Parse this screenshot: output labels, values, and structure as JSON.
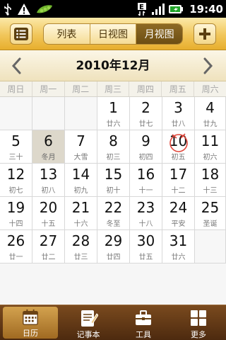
{
  "status_bar": {
    "time": "19:40",
    "left_icons": [
      "usb-icon",
      "warning-icon",
      "peapod-icon"
    ],
    "right_icons": [
      "e-network-icon",
      "signal-icon",
      "battery-icon"
    ]
  },
  "toolbar": {
    "menu_icon": "list-menu-icon",
    "add_icon": "plus-icon",
    "segments": [
      {
        "label": "列表",
        "active": false
      },
      {
        "label": "日视图",
        "active": false
      },
      {
        "label": "月视图",
        "active": true
      }
    ]
  },
  "month_header": {
    "title": "2010年12月",
    "prev_icon": "chevron-left-icon",
    "next_icon": "chevron-right-icon"
  },
  "weekdays": [
    "周日",
    "周一",
    "周二",
    "周三",
    "周四",
    "周五",
    "周六"
  ],
  "calendar": {
    "selected_day": "6",
    "today_marked": "10",
    "weeks": [
      [
        {
          "day": "",
          "lunar": ""
        },
        {
          "day": "",
          "lunar": ""
        },
        {
          "day": "",
          "lunar": ""
        },
        {
          "day": "1",
          "lunar": "廿六"
        },
        {
          "day": "2",
          "lunar": "廿七"
        },
        {
          "day": "3",
          "lunar": "廿八"
        },
        {
          "day": "4",
          "lunar": "廿九"
        }
      ],
      [
        {
          "day": "5",
          "lunar": "三十"
        },
        {
          "day": "6",
          "lunar": "冬月"
        },
        {
          "day": "7",
          "lunar": "大雪"
        },
        {
          "day": "8",
          "lunar": "初三"
        },
        {
          "day": "9",
          "lunar": "初四"
        },
        {
          "day": "10",
          "lunar": "初五"
        },
        {
          "day": "11",
          "lunar": "初六"
        }
      ],
      [
        {
          "day": "12",
          "lunar": "初七"
        },
        {
          "day": "13",
          "lunar": "初八"
        },
        {
          "day": "14",
          "lunar": "初九"
        },
        {
          "day": "15",
          "lunar": "初十"
        },
        {
          "day": "16",
          "lunar": "十一"
        },
        {
          "day": "17",
          "lunar": "十二"
        },
        {
          "day": "18",
          "lunar": "十三"
        }
      ],
      [
        {
          "day": "19",
          "lunar": "十四"
        },
        {
          "day": "20",
          "lunar": "十五"
        },
        {
          "day": "21",
          "lunar": "十六"
        },
        {
          "day": "22",
          "lunar": "冬至"
        },
        {
          "day": "23",
          "lunar": "十八"
        },
        {
          "day": "24",
          "lunar": "平安"
        },
        {
          "day": "25",
          "lunar": "圣诞"
        }
      ],
      [
        {
          "day": "26",
          "lunar": "廿一"
        },
        {
          "day": "27",
          "lunar": "廿二"
        },
        {
          "day": "28",
          "lunar": "廿三"
        },
        {
          "day": "29",
          "lunar": "廿四"
        },
        {
          "day": "30",
          "lunar": "廿五"
        },
        {
          "day": "31",
          "lunar": "廿六"
        },
        {
          "day": "",
          "lunar": ""
        }
      ]
    ]
  },
  "bottom_nav": [
    {
      "label": "日历",
      "icon": "calendar-icon",
      "active": true
    },
    {
      "label": "记事本",
      "icon": "notepad-icon",
      "active": false
    },
    {
      "label": "工具",
      "icon": "toolbox-icon",
      "active": false
    },
    {
      "label": "更多",
      "icon": "more-grid-icon",
      "active": false
    }
  ],
  "colors": {
    "toolbar_gold": "#f1c65a",
    "segment_active": "#7a5a1c",
    "selected_cell": "#ddd8cb",
    "today_circle": "#e0463a",
    "bottom_nav": "#5e3514"
  }
}
